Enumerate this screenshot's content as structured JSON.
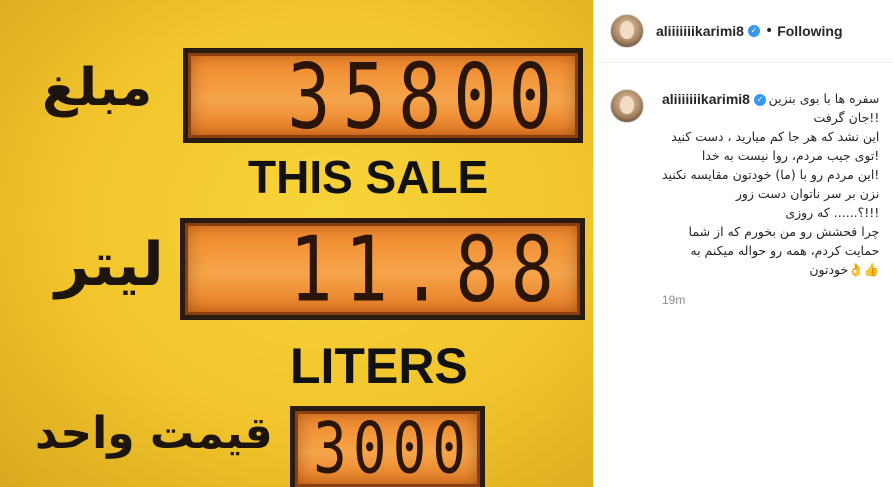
{
  "photo": {
    "amount_label_fa": "مبلغ",
    "amount_value": "35800",
    "this_sale_label": "THIS SALE",
    "liter_label_fa": "لیتر",
    "liters_value": "11.88",
    "liters_label": "LITERS",
    "unit_price_label_fa": "قیمت واحد",
    "unit_price_value": "3000"
  },
  "header": {
    "username": "aliiiiiiikarimi8",
    "verified_icon": "verified-badge-icon",
    "separator": "•",
    "follow_status": "Following"
  },
  "caption": {
    "username": "aliiiiiiikarimi8",
    "lines": [
      "سفره ها با بوی بنزین",
      "!!جان گرفت",
      "این نشد که هر جا کم میارید ، دست کنید",
      "!توی جیب مردم، روا نیست به خدا",
      "!این مردم رو با (ما) خودتون مقایسه نکنید",
      "نزن بر سر ناتوان دست زور",
      "!!!؟...... که روزی",
      "چرا فحشش رو من بخورم که از شما",
      "حمایت کردم، همه رو حواله میکنم به",
      "👍👌خودتون"
    ],
    "timestamp": "19m"
  },
  "colors": {
    "accent_blue": "#3897f0",
    "text_primary": "#262626",
    "text_secondary": "#8e8e8e",
    "pump_yellow": "#f2c52c",
    "display_orange": "#f0872a"
  }
}
